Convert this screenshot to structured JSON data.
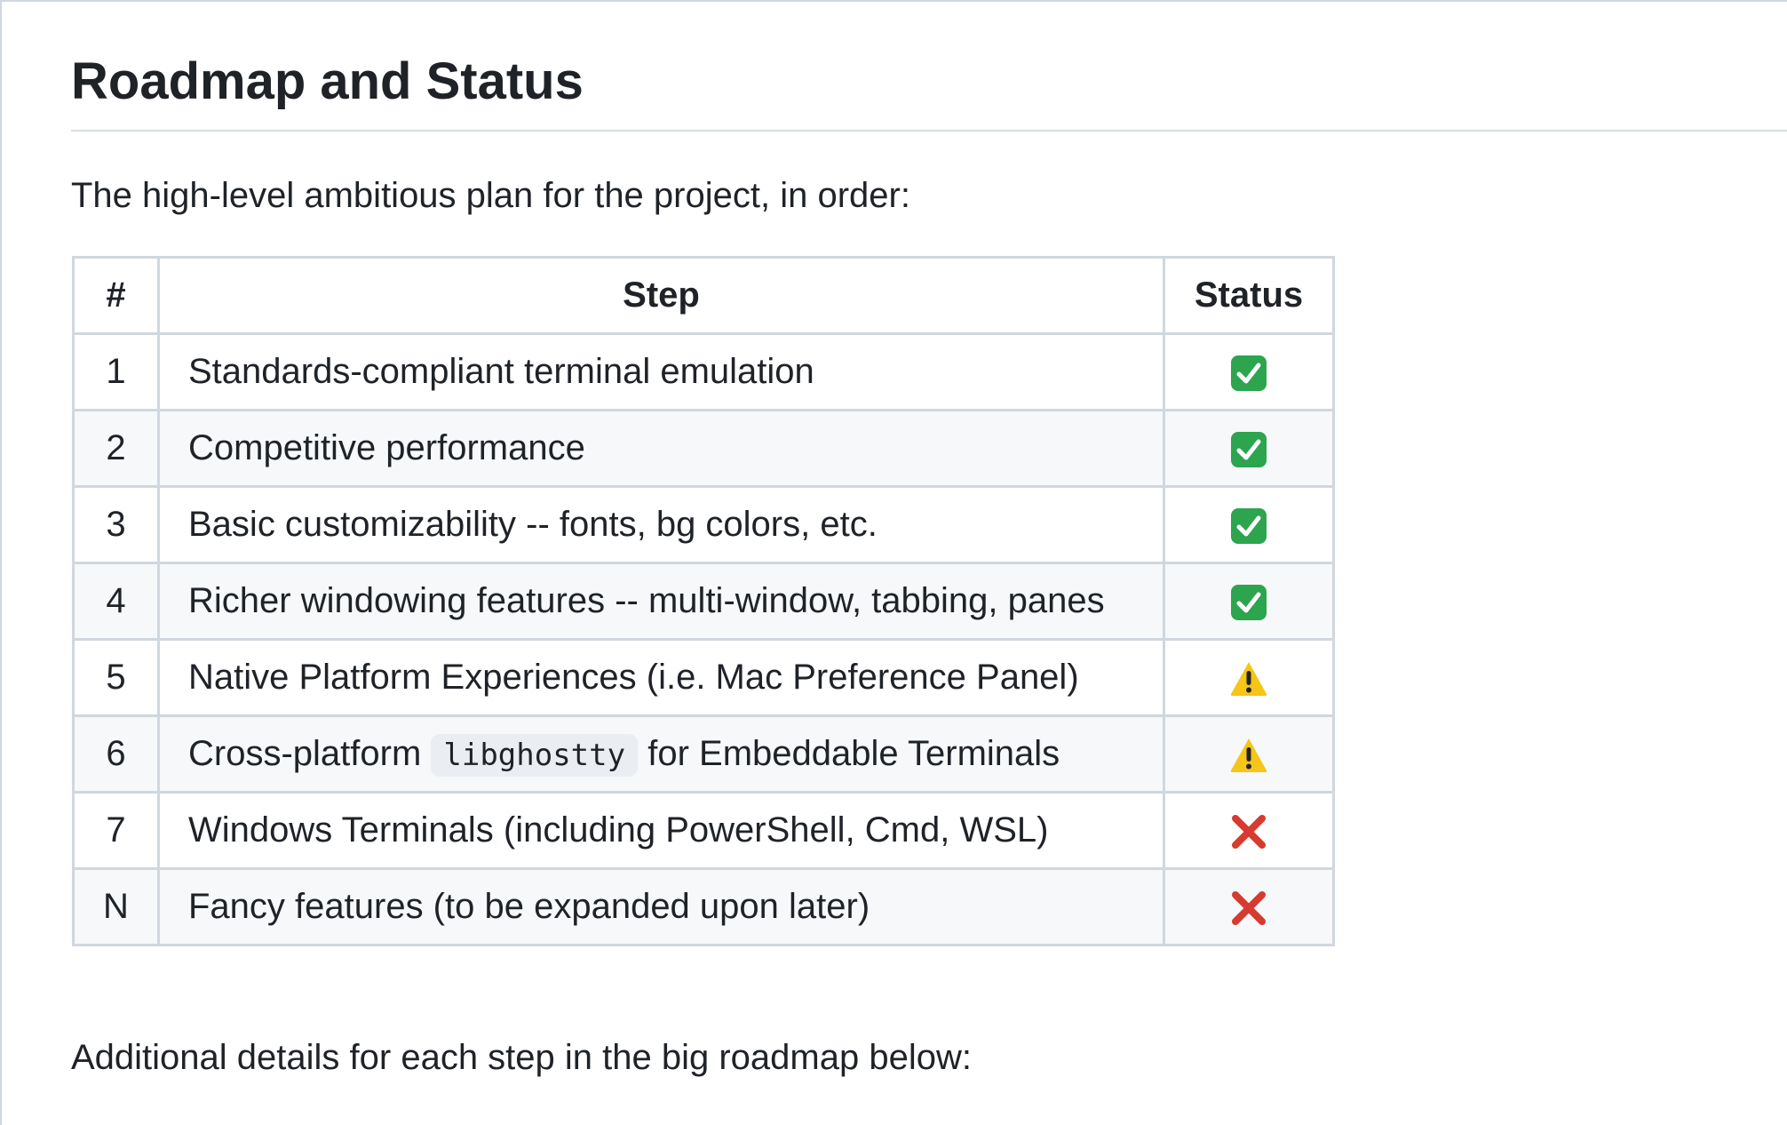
{
  "heading": "Roadmap and Status",
  "intro": "The high-level ambitious plan for the project, in order:",
  "table": {
    "headers": [
      "#",
      "Step",
      "Status"
    ],
    "rows": [
      {
        "num": "1",
        "step": "Standards-compliant terminal emulation",
        "status": "check-mark-icon"
      },
      {
        "num": "2",
        "step": "Competitive performance",
        "status": "check-mark-icon"
      },
      {
        "num": "3",
        "step": "Basic customizability -- fonts, bg colors, etc.",
        "status": "check-mark-icon"
      },
      {
        "num": "4",
        "step": "Richer windowing features -- multi-window, tabbing, panes",
        "status": "check-mark-icon"
      },
      {
        "num": "5",
        "step": "Native Platform Experiences (i.e. Mac Preference Panel)",
        "status": "warning-icon"
      },
      {
        "num": "6",
        "step_before": "Cross-platform",
        "step_code": "libghostty",
        "step_after": "for Embeddable Terminals",
        "status": "warning-icon"
      },
      {
        "num": "7",
        "step": "Windows Terminals (including PowerShell, Cmd, WSL)",
        "status": "cross-mark-icon"
      },
      {
        "num": "N",
        "step": "Fancy features (to be expanded upon later)",
        "status": "cross-mark-icon"
      }
    ]
  },
  "outro": "Additional details for each step in the big roadmap below:",
  "colors": {
    "check": "#2da44e",
    "warning": "#f5c518",
    "cross": "#d73a2f",
    "border": "#d0d7de",
    "stripe": "#f6f8fa"
  }
}
